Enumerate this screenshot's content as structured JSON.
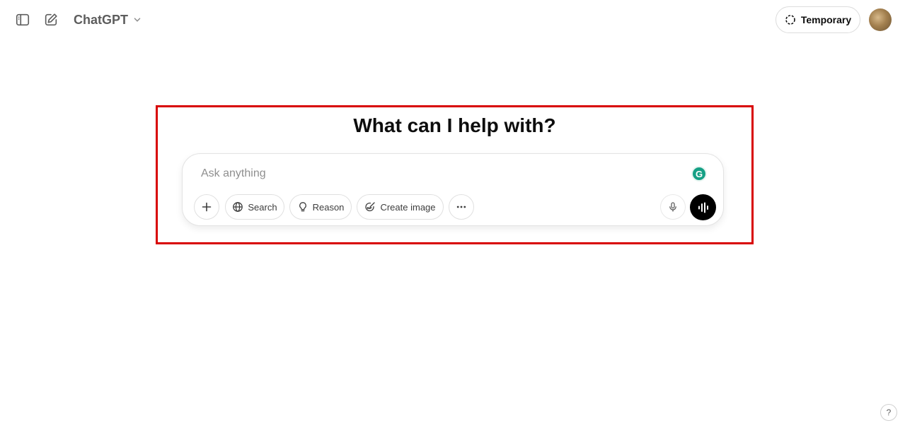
{
  "header": {
    "model_name": "ChatGPT",
    "temporary_label": "Temporary"
  },
  "main": {
    "headline": "What can I help with?"
  },
  "composer": {
    "placeholder": "Ask anything",
    "tools": {
      "search_label": "Search",
      "reason_label": "Reason",
      "create_image_label": "Create image"
    }
  },
  "footer": {
    "help_label": "?"
  },
  "icons": {
    "sidebar": "sidebar-icon",
    "new_chat": "edit-icon",
    "chevron": "chevron-down-icon",
    "temporary": "dashed-circle-icon",
    "plus": "plus-icon",
    "search": "globe-icon",
    "reason": "lightbulb-icon",
    "create_image": "image-brush-icon",
    "more": "more-dots-icon",
    "mic": "microphone-icon",
    "voice": "voice-waveform-icon",
    "grammarly": "grammarly-icon"
  },
  "colors": {
    "highlight": "#d80000",
    "voice_button": "#000000",
    "grammarly": "#15a085"
  }
}
